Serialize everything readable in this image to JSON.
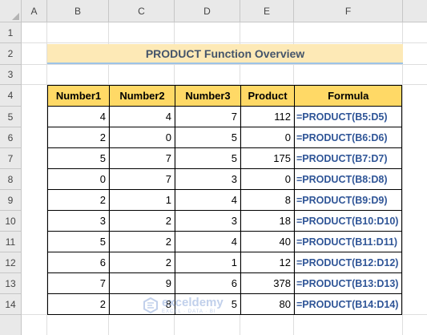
{
  "columns": [
    "A",
    "B",
    "C",
    "D",
    "E",
    "F"
  ],
  "rows": [
    "1",
    "2",
    "3",
    "4",
    "5",
    "6",
    "7",
    "8",
    "9",
    "10",
    "11",
    "12",
    "13",
    "14"
  ],
  "title": "PRODUCT Function Overview",
  "table": {
    "headers": [
      "Number1",
      "Number2",
      "Number3",
      "Product",
      "Formula"
    ],
    "rows": [
      [
        "4",
        "4",
        "7",
        "112",
        "=PRODUCT(B5:D5)"
      ],
      [
        "2",
        "0",
        "5",
        "0",
        "=PRODUCT(B6:D6)"
      ],
      [
        "5",
        "7",
        "5",
        "175",
        "=PRODUCT(B7:D7)"
      ],
      [
        "0",
        "7",
        "3",
        "0",
        "=PRODUCT(B8:D8)"
      ],
      [
        "2",
        "1",
        "4",
        "8",
        "=PRODUCT(B9:D9)"
      ],
      [
        "3",
        "2",
        "3",
        "18",
        "=PRODUCT(B10:D10)"
      ],
      [
        "5",
        "2",
        "4",
        "40",
        "=PRODUCT(B11:D11)"
      ],
      [
        "6",
        "2",
        "1",
        "12",
        "=PRODUCT(B12:D12)"
      ],
      [
        "7",
        "9",
        "6",
        "378",
        "=PRODUCT(B13:D13)"
      ],
      [
        "2",
        "8",
        "5",
        "80",
        "=PRODUCT(B14:D14)"
      ]
    ]
  },
  "watermark": {
    "name": "exceldemy",
    "tagline": "EXCEL · DATA · BI"
  },
  "colors": {
    "title_fill": "#fde9b6",
    "header_fill": "#ffd966",
    "formula_text": "#2f5597"
  }
}
